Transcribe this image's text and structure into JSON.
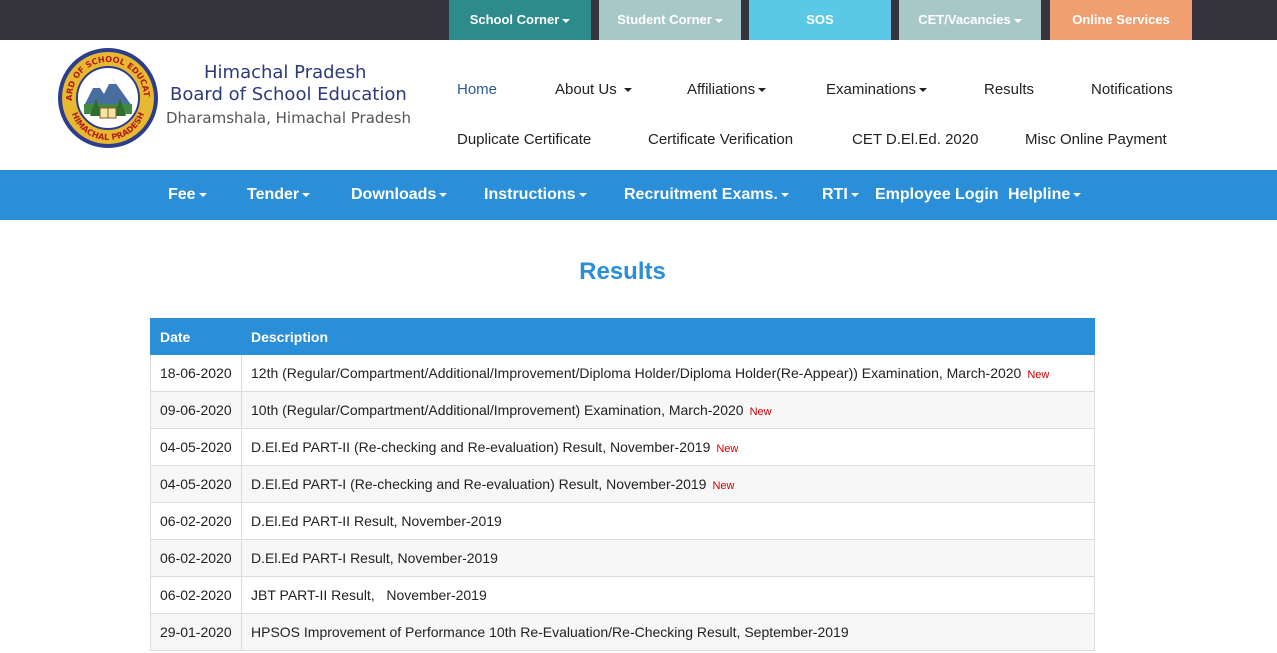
{
  "topbar": {
    "items": [
      {
        "label": "School Corner",
        "dropdown": true,
        "color": "#2e8b8b"
      },
      {
        "label": "Student Corner",
        "dropdown": true,
        "color": "#a8c8c8"
      },
      {
        "label": "SOS",
        "dropdown": false,
        "color": "#5bc8e6"
      },
      {
        "label": "CET/Vacancies",
        "dropdown": true,
        "color": "#a8c8c8"
      },
      {
        "label": "Online Services",
        "dropdown": false,
        "color": "#f0a070"
      }
    ]
  },
  "brand": {
    "line1": "Himachal Pradesh",
    "line2": "Board of School Education",
    "line3": "Dharamshala, Himachal Pradesh",
    "logo_text_top": "BOARD OF SCHOOL EDUCATION",
    "logo_text_bottom": "HIMACHAL PRADESH"
  },
  "nav": {
    "row1": [
      {
        "label": "Home",
        "dropdown": false,
        "active": true
      },
      {
        "label": "About Us",
        "dropdown": true
      },
      {
        "label": "Affiliations",
        "dropdown": true
      },
      {
        "label": "Examinations",
        "dropdown": true
      },
      {
        "label": "Results",
        "dropdown": false
      },
      {
        "label": "Notifications",
        "dropdown": false
      }
    ],
    "row2": [
      {
        "label": "Duplicate Certificate"
      },
      {
        "label": "Certificate Verification"
      },
      {
        "label": "CET D.El.Ed. 2020"
      },
      {
        "label": "Misc Online Payment"
      }
    ]
  },
  "menu": {
    "items": [
      {
        "label": "Fee",
        "dropdown": true
      },
      {
        "label": "Tender",
        "dropdown": true
      },
      {
        "label": "Downloads",
        "dropdown": true
      },
      {
        "label": "Instructions",
        "dropdown": true
      },
      {
        "label": "Recruitment Exams.",
        "dropdown": true
      },
      {
        "label": "RTI",
        "dropdown": true
      },
      {
        "label": "Employee Login",
        "dropdown": false
      },
      {
        "label": "Helpline",
        "dropdown": true
      }
    ]
  },
  "page": {
    "title": "Results"
  },
  "table": {
    "headers": [
      "Date",
      "Description"
    ],
    "new_label": "New",
    "rows": [
      {
        "date": "18-06-2020",
        "description": "12th (Regular/Compartment/Additional/Improvement/Diploma Holder/Diploma Holder(Re-Appear)) Examination, March-2020",
        "new": true
      },
      {
        "date": "09-06-2020",
        "description": "10th (Regular/Compartment/Additional/Improvement) Examination, March-2020",
        "new": true
      },
      {
        "date": "04-05-2020",
        "description": "D.El.Ed PART-II (Re-checking and Re-evaluation) Result, November-2019",
        "new": true
      },
      {
        "date": "04-05-2020",
        "description": "D.El.Ed PART-I (Re-checking and Re-evaluation) Result, November-2019",
        "new": true
      },
      {
        "date": "06-02-2020",
        "description": "D.El.Ed PART-II Result, November-2019",
        "new": false
      },
      {
        "date": "06-02-2020",
        "description": "D.El.Ed PART-I Result, November-2019",
        "new": false
      },
      {
        "date": "06-02-2020",
        "description": "JBT PART-II Result,   November-2019",
        "new": false
      },
      {
        "date": "29-01-2020",
        "description": "HPSOS Improvement of Performance 10th Re-Evaluation/Re-Checking Result, September-2019",
        "new": false
      }
    ]
  }
}
